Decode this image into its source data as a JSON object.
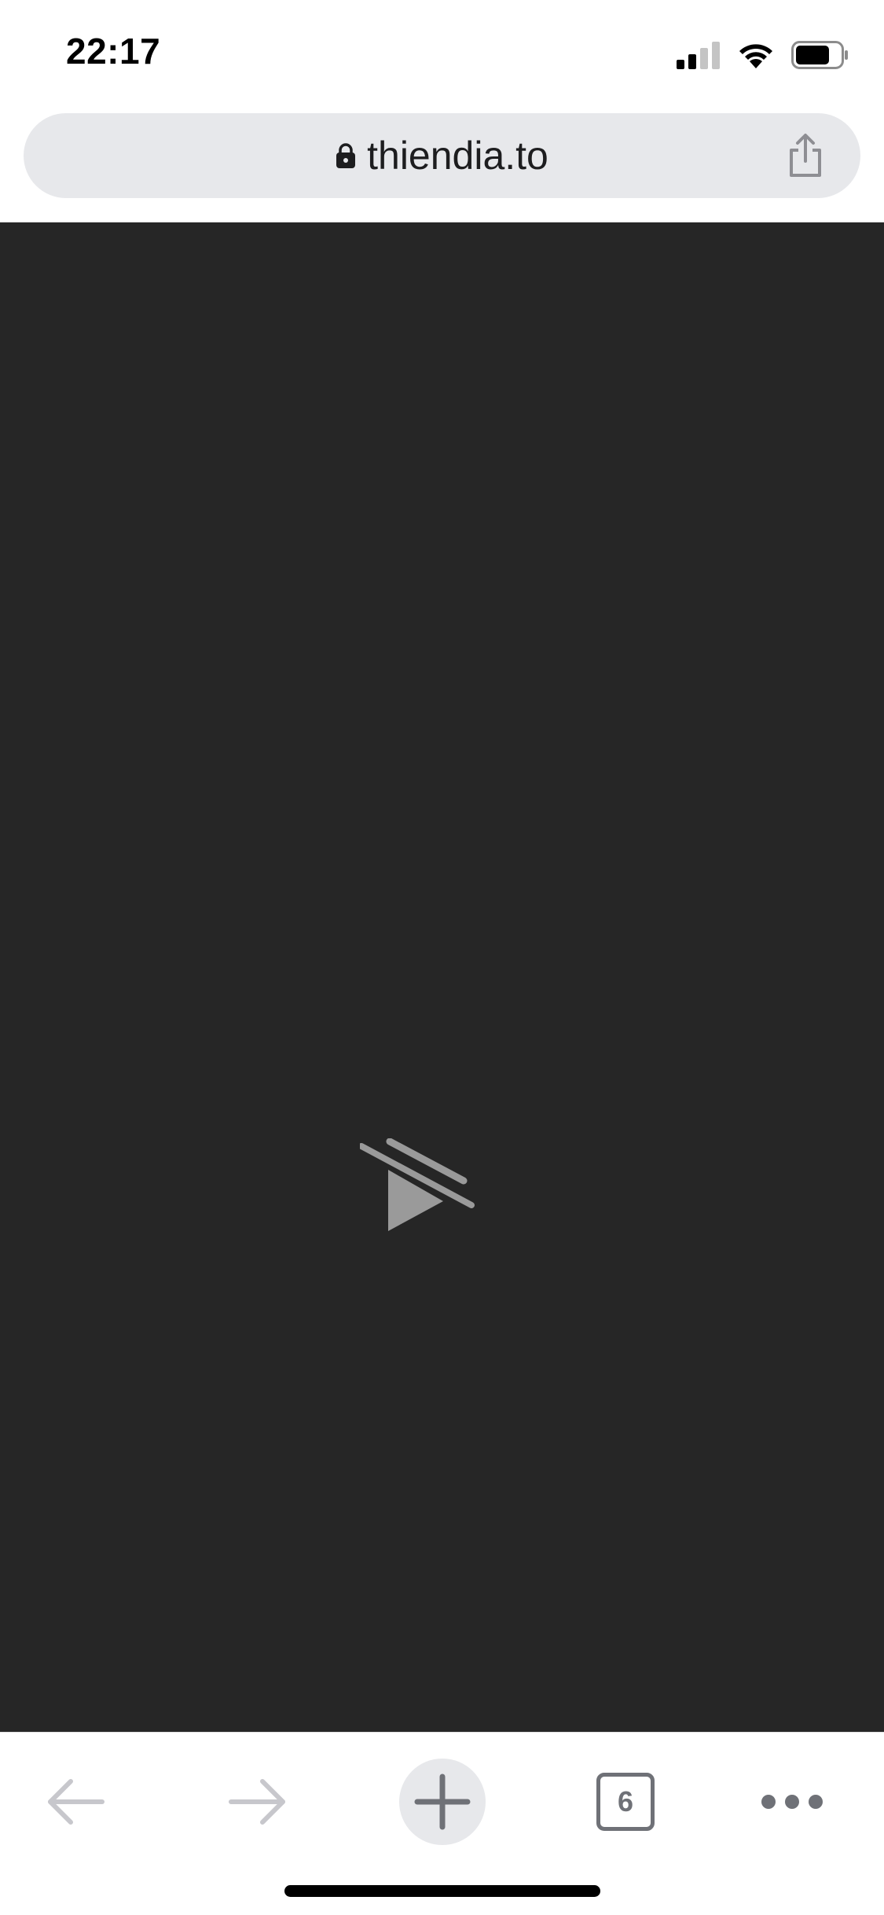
{
  "status_bar": {
    "time": "22:17",
    "icons": [
      "cellular-signal-icon",
      "wifi-icon",
      "battery-icon"
    ]
  },
  "address_bar": {
    "url": "thiendia.to",
    "secure_icon": "lock-icon",
    "share_icon": "share-icon"
  },
  "video": {
    "icon": "play-disabled-icon",
    "background": "#262626"
  },
  "toolbar": {
    "back_icon": "arrow-left-icon",
    "forward_icon": "arrow-right-icon",
    "new_tab_icon": "plus-icon",
    "tab_count": "6",
    "more_icon": "more-dots-icon"
  },
  "colors": {
    "bar_background": "#e7e8eb",
    "icon_gray": "#6f7177",
    "disabled_gray": "#c7c7cc"
  }
}
